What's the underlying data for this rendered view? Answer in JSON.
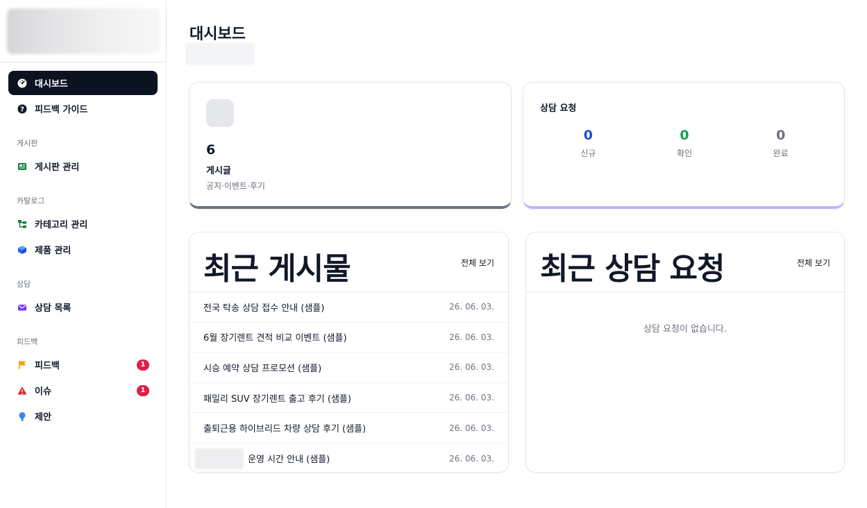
{
  "sidebar": {
    "items": {
      "dashboard": "대시보드",
      "feedback_guide": "피드백 가이드",
      "board_manage": "게시판 관리",
      "category_manage": "카테고리 관리",
      "product_manage": "제품 관리",
      "consult_list": "상담 목록",
      "feedback": "피드백",
      "issue": "이슈",
      "suggestion": "제안"
    },
    "sections": {
      "board": "게시판",
      "catalog": "카탈로그",
      "consult": "상담",
      "feedback": "피드백"
    },
    "badges": {
      "feedback": "1",
      "issue": "1"
    }
  },
  "page": {
    "title": "대시보드"
  },
  "posts_card": {
    "count": "6",
    "label": "게시글",
    "desc": "공지·이벤트·후기"
  },
  "consult_card": {
    "title": "상담 요청",
    "stats": [
      {
        "value": "0",
        "label": "신규",
        "color": "#1d4ed8"
      },
      {
        "value": "0",
        "label": "확인",
        "color": "#16a34a"
      },
      {
        "value": "0",
        "label": "완료",
        "color": "#6b7280"
      }
    ]
  },
  "recent_posts": {
    "title": "최근 게시물",
    "view_all": "전체 보기",
    "rows": [
      {
        "title": "전국 탁송 상담 접수 안내 (샘플)",
        "date": "26. 06. 03."
      },
      {
        "title": "6월 장기렌트 견적 비교 이벤트 (샘플)",
        "date": "26. 06. 03."
      },
      {
        "title": "시승 예약 상담 프로모션 (샘플)",
        "date": "26. 06. 03."
      },
      {
        "title": "패밀리 SUV 장기렌트 출고 후기 (샘플)",
        "date": "26. 06. 03."
      },
      {
        "title": "출퇴근용 하이브리드 차량 상담 후기 (샘플)",
        "date": "26. 06. 03."
      },
      {
        "title": "운영 시간 안내 (샘플)",
        "date": "26. 06. 03."
      }
    ]
  },
  "recent_consults": {
    "title": "최근 상담 요청",
    "view_all": "전체 보기",
    "empty": "상담 요청이 없습니다."
  },
  "colors": {
    "accent_dark": "#0b1220",
    "badge_red": "#e11d48",
    "posts_bar": "#6b7280",
    "consult_bar": "#c4b5fd"
  }
}
